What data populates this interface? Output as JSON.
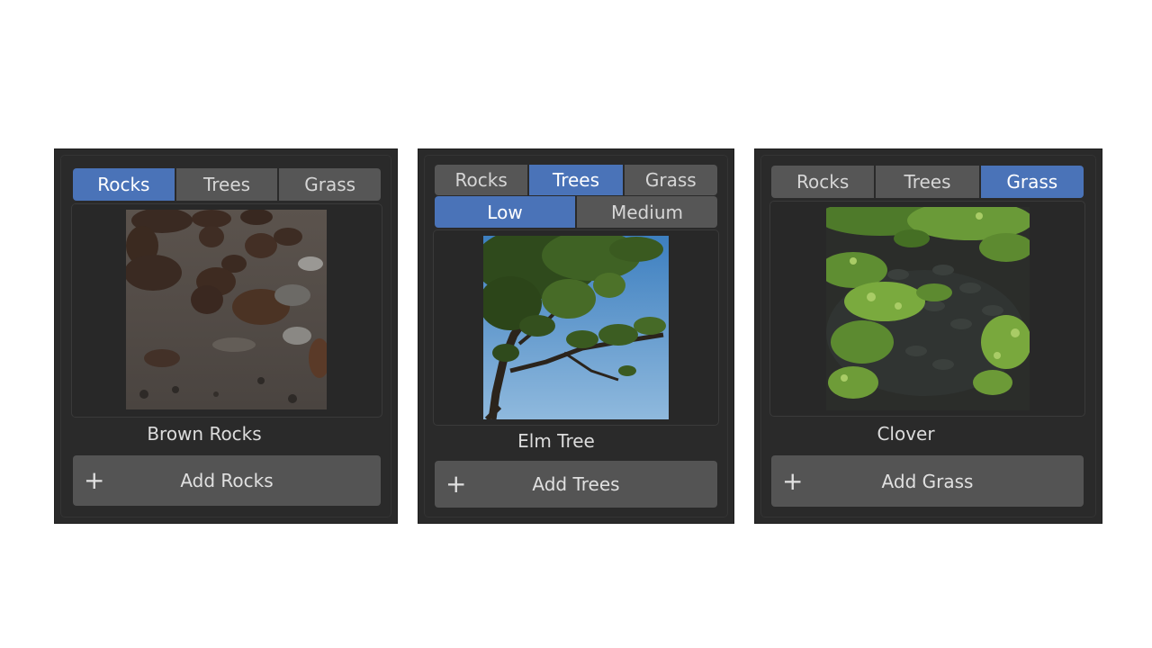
{
  "panels": [
    {
      "tabs": [
        "Rocks",
        "Trees",
        "Grass"
      ],
      "active_tab": "Rocks",
      "item_name": "Brown Rocks",
      "add_label": "Add Rocks",
      "plus_icon": "plus-icon"
    },
    {
      "tabs": [
        "Rocks",
        "Trees",
        "Grass"
      ],
      "active_tab": "Trees",
      "subtabs": [
        "Low",
        "Medium"
      ],
      "active_subtab": "Low",
      "item_name": "Elm Tree",
      "add_label": "Add Trees",
      "plus_icon": "plus-icon"
    },
    {
      "tabs": [
        "Rocks",
        "Trees",
        "Grass"
      ],
      "active_tab": "Grass",
      "item_name": "Clover",
      "add_label": "Add Grass",
      "plus_icon": "plus-icon"
    }
  ],
  "plus_glyph": "+",
  "colors": {
    "panel_bg": "#2a2a2a",
    "tab_bg": "#565656",
    "tab_active": "#4a73b8",
    "button_bg": "#545454"
  }
}
